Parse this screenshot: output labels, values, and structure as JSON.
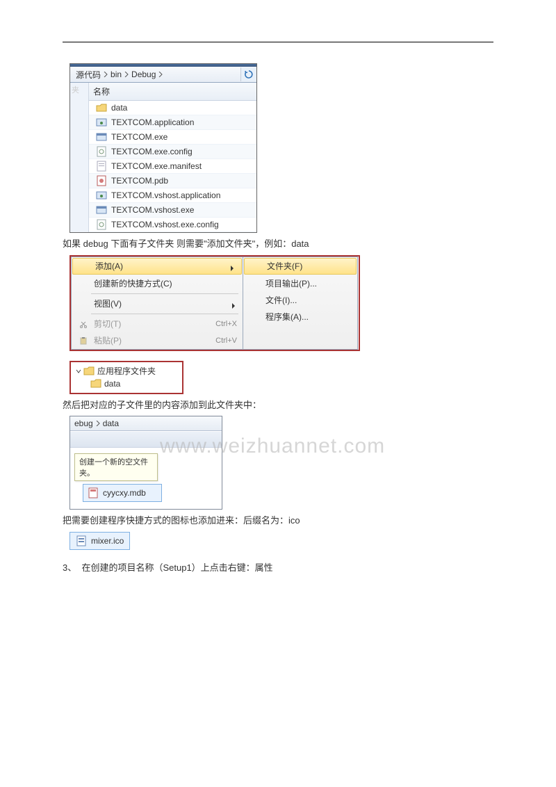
{
  "explorer1": {
    "breadcrumb": [
      "源代码",
      "bin",
      "Debug"
    ],
    "nameHeader": "名称",
    "leftLabel": "夹",
    "files": [
      {
        "name": "data",
        "icon": "folder"
      },
      {
        "name": "TEXTCOM.application",
        "icon": "app"
      },
      {
        "name": "TEXTCOM.exe",
        "icon": "exe"
      },
      {
        "name": "TEXTCOM.exe.config",
        "icon": "config"
      },
      {
        "name": "TEXTCOM.exe.manifest",
        "icon": "manifest"
      },
      {
        "name": "TEXTCOM.pdb",
        "icon": "pdb"
      },
      {
        "name": "TEXTCOM.vshost.application",
        "icon": "app"
      },
      {
        "name": "TEXTCOM.vshost.exe",
        "icon": "exe"
      },
      {
        "name": "TEXTCOM.vshost.exe.config",
        "icon": "config"
      }
    ]
  },
  "para1": "如果 debug  下面有子文件夹  则需要\"添加文件夹\"，例如：data",
  "menuLeft": {
    "items": [
      {
        "label": "添加(A)",
        "arrow": true,
        "highlight": true
      },
      {
        "label": "创建新的快捷方式(C)"
      },
      {
        "label": "视图(V)",
        "arrow": true
      },
      {
        "label": "剪切(T)",
        "shortcut": "Ctrl+X",
        "disabled": true,
        "icon": "cut"
      },
      {
        "label": "粘贴(P)",
        "shortcut": "Ctrl+V",
        "disabled": true,
        "icon": "paste"
      }
    ]
  },
  "menuRight": {
    "items": [
      {
        "label": "文件夹(F)",
        "highlight": true
      },
      {
        "label": "项目输出(P)..."
      },
      {
        "label": "文件(I)..."
      },
      {
        "label": "程序集(A)..."
      }
    ]
  },
  "tree": {
    "parent": "应用程序文件夹",
    "child": "data"
  },
  "para2": "然后把对应的子文件里的内容添加到此文件夹中：",
  "explorer2": {
    "crumb": [
      "ebug",
      "data"
    ],
    "tooltip": "创建一个新的空文件夹。",
    "file": "cyycxy.mdb"
  },
  "para3": "把需要创建程序快捷方式的图标也添加进来：后缀名为：ico",
  "icofile": "mixer.ico",
  "step3": {
    "num": "3、",
    "text": "在创建的项目名称（Setup1）上点击右键：属性"
  },
  "watermark": "www.weizhuannet.com"
}
